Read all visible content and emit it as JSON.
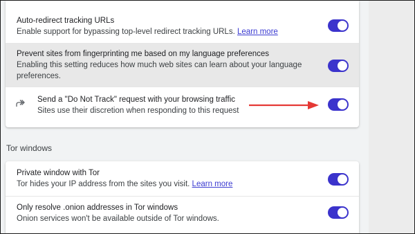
{
  "settings_card": {
    "rows": [
      {
        "label": "Auto-redirect tracking URLs",
        "description": "Enable support for bypassing top-level redirect tracking URLs.",
        "link": "Learn more",
        "enabled": true
      },
      {
        "label": "Prevent sites from fingerprinting me based on my language preferences",
        "description_line1": "Enabling this setting reduces how much web sites can learn about your language",
        "description_line2": "preferences.",
        "enabled": true
      },
      {
        "icon": "external-share-arrow-icon",
        "label": "Send a \"Do Not Track\" request with your browsing traffic",
        "description": "Sites use their discretion when responding to this request",
        "enabled": true
      }
    ]
  },
  "tor_section": {
    "title": "Tor windows",
    "rows": [
      {
        "label": "Private window with Tor",
        "description": "Tor hides your IP address from the sites you visit.",
        "link": "Learn more",
        "enabled": true
      },
      {
        "label": "Only resolve .onion addresses in Tor windows",
        "description": "Onion services won't be available outside of Tor windows.",
        "enabled": true
      }
    ]
  },
  "colors": {
    "toggle_on": "#3b33cc",
    "link": "#3b3bd1",
    "annotation_arrow": "#e53935",
    "highlight_row": "#e8e8e8"
  }
}
